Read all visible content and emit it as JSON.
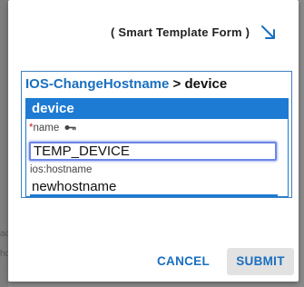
{
  "dialog": {
    "title": "( Smart Template Form )",
    "expand_icon": "arrow-down-right-icon"
  },
  "breadcrumb": {
    "parent": "IOS-ChangeHostname",
    "separator": ">",
    "current": "device"
  },
  "section": {
    "title": "device"
  },
  "fields": {
    "name": {
      "required_marker": "*",
      "label": "name",
      "key_icon": "key-icon",
      "value": "TEMP_DEVICE"
    },
    "hostname": {
      "label": "ios:hostname",
      "value": "newhostname"
    }
  },
  "buttons": {
    "cancel": "CANCEL",
    "submit": "SUBMIT"
  },
  "colors": {
    "accent": "#1d7bd3",
    "link": "#1a6fbf",
    "required": "#d01c1c",
    "focus_border": "#6d86e6"
  }
}
